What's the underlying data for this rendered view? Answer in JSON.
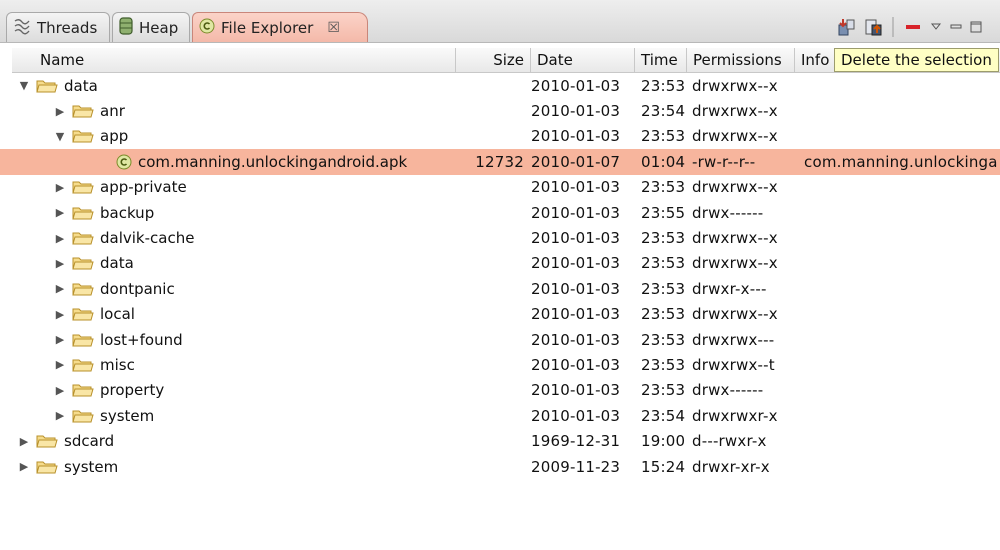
{
  "tabs": [
    {
      "label": "Threads",
      "icon": "threads-icon",
      "active": false
    },
    {
      "label": "Heap",
      "icon": "heap-icon",
      "active": false
    },
    {
      "label": "File Explorer",
      "icon": "android-icon",
      "active": true,
      "close": "☒"
    }
  ],
  "toolbar": {
    "buttons": [
      "pull-file-icon",
      "push-file-icon",
      "delete-icon",
      "view-menu-icon",
      "minimize-icon",
      "maximize-icon"
    ],
    "tooltip": "Delete the selection"
  },
  "columns": {
    "name": "Name",
    "size": "Size",
    "date": "Date",
    "time": "Time",
    "permissions": "Permissions",
    "info": "Info"
  },
  "colors": {
    "selection": "#f7b59d",
    "folder": "#f0c860",
    "tooltip_bg": "#ffffc4"
  },
  "rows": [
    {
      "name": "data",
      "level": 0,
      "type": "folder",
      "expanded": true,
      "size": "",
      "date": "2010-01-03",
      "time": "23:53",
      "perm": "drwxrwx--x",
      "info": ""
    },
    {
      "name": "anr",
      "level": 1,
      "type": "folder",
      "expanded": false,
      "size": "",
      "date": "2010-01-03",
      "time": "23:54",
      "perm": "drwxrwx--x",
      "info": ""
    },
    {
      "name": "app",
      "level": 1,
      "type": "folder",
      "expanded": true,
      "size": "",
      "date": "2010-01-03",
      "time": "23:53",
      "perm": "drwxrwx--x",
      "info": ""
    },
    {
      "name": "com.manning.unlockingandroid.apk",
      "level": 2,
      "type": "file",
      "selected": true,
      "size": "12732",
      "date": "2010-01-07",
      "time": "01:04",
      "perm": "-rw-r--r--",
      "info": "com.manning.unlockinga"
    },
    {
      "name": "app-private",
      "level": 1,
      "type": "folder",
      "expanded": false,
      "size": "",
      "date": "2010-01-03",
      "time": "23:53",
      "perm": "drwxrwx--x",
      "info": ""
    },
    {
      "name": "backup",
      "level": 1,
      "type": "folder",
      "expanded": false,
      "size": "",
      "date": "2010-01-03",
      "time": "23:55",
      "perm": "drwx------",
      "info": ""
    },
    {
      "name": "dalvik-cache",
      "level": 1,
      "type": "folder",
      "expanded": false,
      "size": "",
      "date": "2010-01-03",
      "time": "23:53",
      "perm": "drwxrwx--x",
      "info": ""
    },
    {
      "name": "data",
      "level": 1,
      "type": "folder",
      "expanded": false,
      "size": "",
      "date": "2010-01-03",
      "time": "23:53",
      "perm": "drwxrwx--x",
      "info": ""
    },
    {
      "name": "dontpanic",
      "level": 1,
      "type": "folder",
      "expanded": false,
      "size": "",
      "date": "2010-01-03",
      "time": "23:53",
      "perm": "drwxr-x---",
      "info": ""
    },
    {
      "name": "local",
      "level": 1,
      "type": "folder",
      "expanded": false,
      "size": "",
      "date": "2010-01-03",
      "time": "23:53",
      "perm": "drwxrwx--x",
      "info": ""
    },
    {
      "name": "lost+found",
      "level": 1,
      "type": "folder",
      "expanded": false,
      "size": "",
      "date": "2010-01-03",
      "time": "23:53",
      "perm": "drwxrwx---",
      "info": ""
    },
    {
      "name": "misc",
      "level": 1,
      "type": "folder",
      "expanded": false,
      "size": "",
      "date": "2010-01-03",
      "time": "23:53",
      "perm": "drwxrwx--t",
      "info": ""
    },
    {
      "name": "property",
      "level": 1,
      "type": "folder",
      "expanded": false,
      "size": "",
      "date": "2010-01-03",
      "time": "23:53",
      "perm": "drwx------",
      "info": ""
    },
    {
      "name": "system",
      "level": 1,
      "type": "folder",
      "expanded": false,
      "size": "",
      "date": "2010-01-03",
      "time": "23:54",
      "perm": "drwxrwxr-x",
      "info": ""
    },
    {
      "name": "sdcard",
      "level": 0,
      "type": "folder",
      "expanded": false,
      "size": "",
      "date": "1969-12-31",
      "time": "19:00",
      "perm": "d---rwxr-x",
      "info": ""
    },
    {
      "name": "system",
      "level": 0,
      "type": "folder",
      "expanded": false,
      "size": "",
      "date": "2009-11-23",
      "time": "15:24",
      "perm": "drwxr-xr-x",
      "info": ""
    }
  ]
}
